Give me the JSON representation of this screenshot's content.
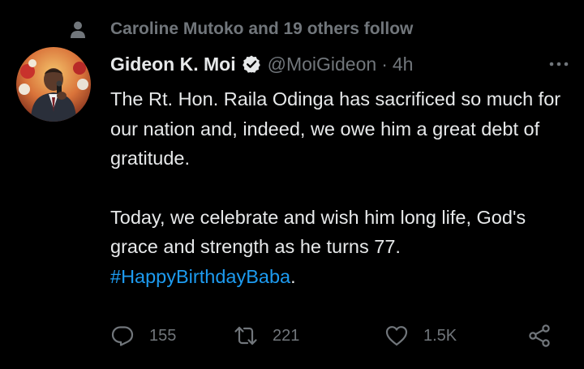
{
  "social_context": {
    "icon": "person-icon",
    "text": "Caroline Mutoko and 19 others follow"
  },
  "author": {
    "display_name": "Gideon K. Moi",
    "verified_icon": "verified-badge-icon",
    "handle": "@MoiGideon",
    "separator": "·",
    "time": "4h"
  },
  "tweet": {
    "paragraph_1": "The Rt. Hon. Raila Odinga has sacrificed so much for our nation and, indeed, we owe him a great debt of gratitude.",
    "paragraph_2": "Today, we celebrate and wish him long life, God's grace and strength as he turns 77.",
    "hashtag": "#HappyBirthdayBaba",
    "trailing": "."
  },
  "actions": {
    "reply": {
      "icon": "reply-icon",
      "count": "155"
    },
    "retweet": {
      "icon": "retweet-icon",
      "count": "221"
    },
    "like": {
      "icon": "heart-icon",
      "count": "1.5K"
    },
    "share": {
      "icon": "share-icon"
    }
  },
  "colors": {
    "background": "#000000",
    "primary_text": "#e7e9ea",
    "secondary_text": "#71767b",
    "link": "#1d9bf0"
  }
}
